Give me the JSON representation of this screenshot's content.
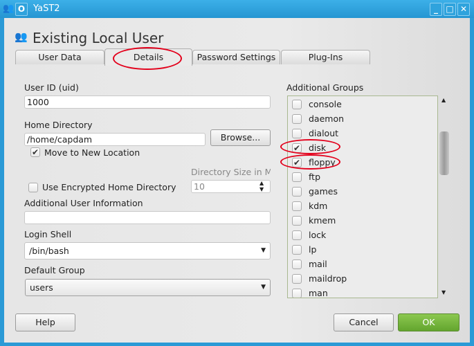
{
  "window": {
    "title": "YaST2",
    "buttons": [
      "minimize",
      "maximize",
      "close"
    ]
  },
  "header": {
    "title": "Existing Local User"
  },
  "tabs": [
    {
      "label": "User Data",
      "active": false
    },
    {
      "label": "Details",
      "active": true
    },
    {
      "label": "Password Settings",
      "active": false
    },
    {
      "label": "Plug-Ins",
      "active": false
    }
  ],
  "form": {
    "uid_label": "User ID (uid)",
    "uid_value": "1000",
    "home_label": "Home Directory",
    "home_value": "/home/capdam",
    "browse_label": "Browse...",
    "move_label": "Move to New Location",
    "move_checked": true,
    "dirsize_label": "Directory Size in MB",
    "dirsize_value": "10",
    "encrypt_label": "Use Encrypted Home Directory",
    "encrypt_checked": false,
    "info_label": "Additional User Information",
    "info_value": "",
    "shell_label": "Login Shell",
    "shell_value": "/bin/bash",
    "group_label": "Default Group",
    "group_value": "users"
  },
  "groups": {
    "label": "Additional Groups",
    "items": [
      {
        "name": "console",
        "checked": false
      },
      {
        "name": "daemon",
        "checked": false
      },
      {
        "name": "dialout",
        "checked": false
      },
      {
        "name": "disk",
        "checked": true
      },
      {
        "name": "floppy",
        "checked": true
      },
      {
        "name": "ftp",
        "checked": false
      },
      {
        "name": "games",
        "checked": false
      },
      {
        "name": "kdm",
        "checked": false
      },
      {
        "name": "kmem",
        "checked": false
      },
      {
        "name": "lock",
        "checked": false
      },
      {
        "name": "lp",
        "checked": false
      },
      {
        "name": "mail",
        "checked": false
      },
      {
        "name": "maildrop",
        "checked": false
      },
      {
        "name": "man",
        "checked": false
      }
    ]
  },
  "footer": {
    "help": "Help",
    "cancel": "Cancel",
    "ok": "OK"
  },
  "colors": {
    "titlebar": "#2b9ad6",
    "ok": "#6fae3a",
    "annotation": "#e3001b"
  }
}
